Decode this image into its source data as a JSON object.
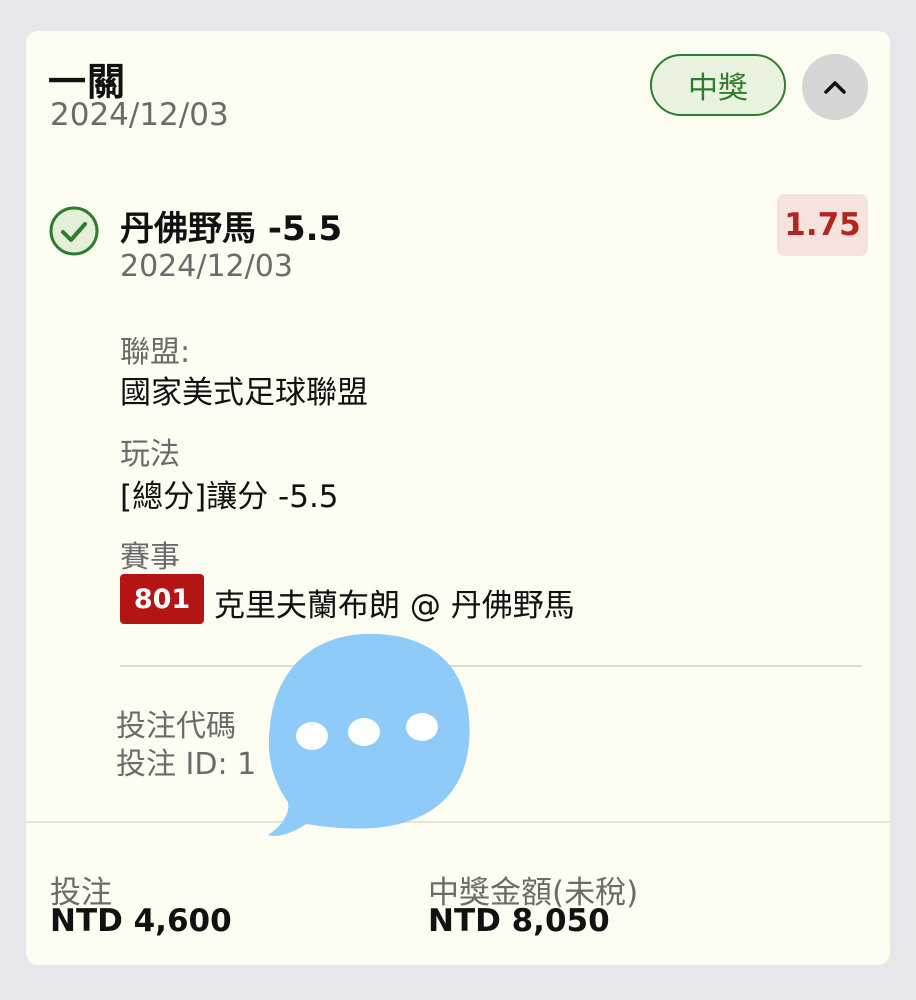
{
  "header": {
    "title": "一關",
    "date": "2024/12/03",
    "status_badge": "中獎"
  },
  "selection": {
    "name": "丹佛野馬 -5.5",
    "date": "2024/12/03",
    "odds": "1.75"
  },
  "details": {
    "league_label": "聯盟:",
    "league_value": "國家美式足球聯盟",
    "market_label": "玩法",
    "market_value": "[總分]讓分 -5.5",
    "event_label": "賽事",
    "event_number": "801",
    "event_name": "克里夫蘭布朗 @ 丹佛野馬"
  },
  "bet_info": {
    "code_label": "投注代碼",
    "id_label": "投注 ID: 1"
  },
  "footer": {
    "stake_label": "投注",
    "stake_value": "NTD 4,600",
    "payout_label": "中獎金額(未稅)",
    "payout_value": "NTD 8,050"
  },
  "colors": {
    "win_green": "#2e7d2e",
    "odds_red": "#b3261e",
    "event_badge_red": "#b31515",
    "chat_blue": "#8fcbf9"
  },
  "icons": {
    "check": "check-circle-icon",
    "collapse": "chevron-up-icon",
    "chat": "chat-bubble-icon"
  }
}
